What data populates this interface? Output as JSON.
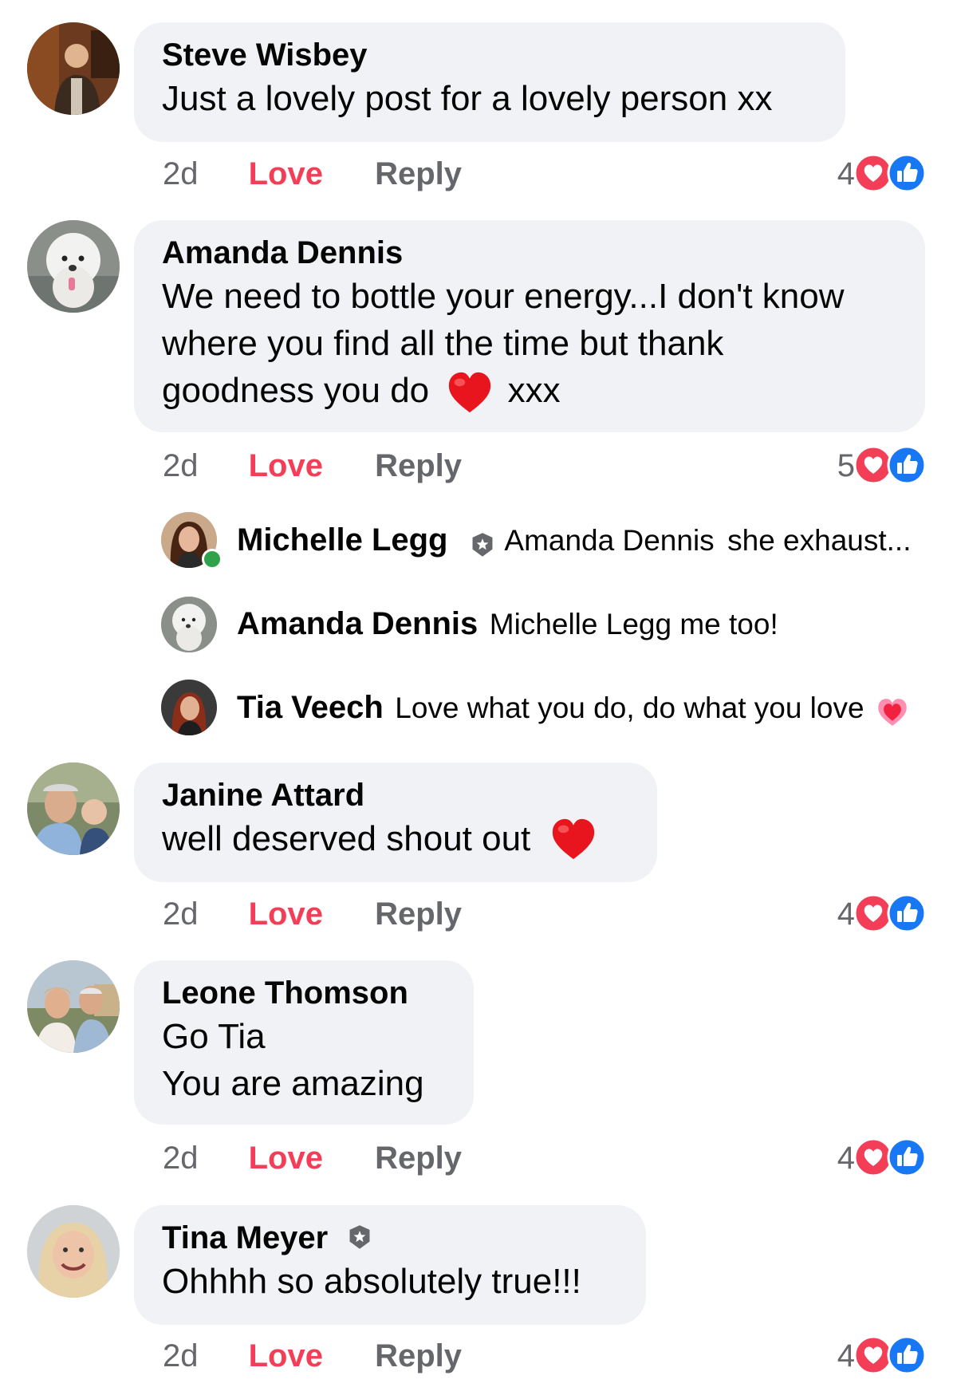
{
  "comments": [
    {
      "author": "Steve Wisbey",
      "text": "Just a lovely post for a lovely person xx",
      "time": "2d",
      "love": "Love",
      "reply": "Reply",
      "reaction_count": "4"
    },
    {
      "author": "Amanda Dennis",
      "text_lines": [
        "We need to bottle your energy...I don't know",
        "where you find all the time but thank",
        "goodness you do",
        "xxx"
      ],
      "time": "2d",
      "love": "Love",
      "reply": "Reply",
      "reaction_count": "5"
    },
    {
      "author": "Janine Attard",
      "text": "well deserved shout out",
      "time": "2d",
      "love": "Love",
      "reply": "Reply",
      "reaction_count": "4"
    },
    {
      "author": "Leone Thomson",
      "text_lines": [
        "Go Tia",
        "You are amazing"
      ],
      "time": "2d",
      "love": "Love",
      "reply": "Reply",
      "reaction_count": "4"
    },
    {
      "author": "Tina Meyer",
      "text": "Ohhhh so absolutely true!!!",
      "time": "2d",
      "love": "Love",
      "reply": "Reply",
      "reaction_count": "4"
    }
  ],
  "replies": [
    {
      "author": "Michelle Legg",
      "mention": "Amanda Dennis",
      "text": "she exhaust..."
    },
    {
      "author": "Amanda Dennis",
      "text": "Michelle Legg me too!"
    },
    {
      "author": "Tia Veech",
      "text": "Love what you do, do what you love"
    }
  ],
  "colors": {
    "bubble": "#f0f2f5",
    "love": "#f33e58",
    "like": "#1877f2",
    "muted": "#65676b",
    "online": "#31a24c"
  },
  "icons": [
    "love-reaction-icon",
    "like-reaction-icon",
    "top-fan-badge-icon",
    "red-heart-emoji-icon",
    "sparkling-heart-emoji-icon"
  ]
}
